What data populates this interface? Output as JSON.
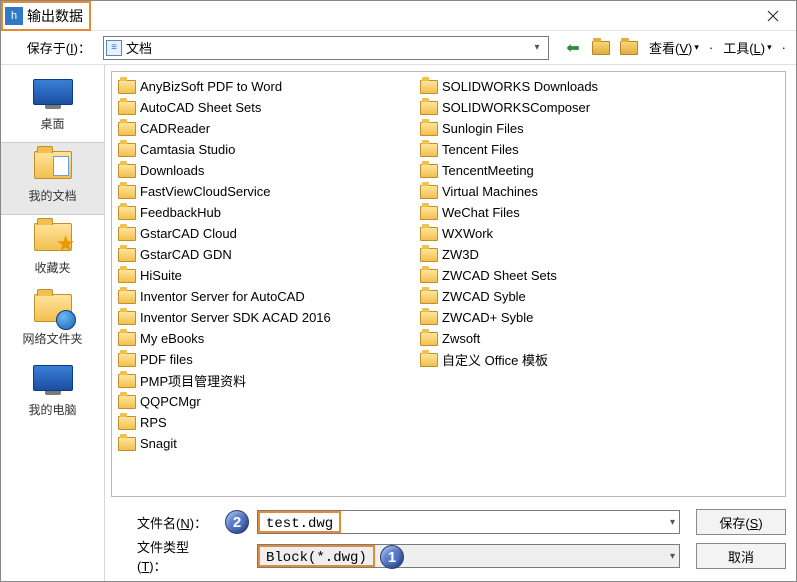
{
  "title": "输出数据",
  "labels": {
    "save_in": "保存于(I)：",
    "filename": "文件名(N)：",
    "filetype": "文件类型(T)："
  },
  "save_in_value": "文档",
  "toolbar_menu": {
    "view": "查看(V)",
    "tools": "工具(L)"
  },
  "places": [
    {
      "label": "桌面"
    },
    {
      "label": "我的文档",
      "selected": true
    },
    {
      "label": "收藏夹"
    },
    {
      "label": "网络文件夹"
    },
    {
      "label": "我的电脑"
    }
  ],
  "folders_col1": [
    "AnyBizSoft PDF to Word",
    "AutoCAD Sheet Sets",
    "CADReader",
    "Camtasia Studio",
    "Downloads",
    "FastViewCloudService",
    "FeedbackHub",
    "GstarCAD Cloud",
    "GstarCAD GDN",
    "HiSuite",
    "Inventor Server for AutoCAD",
    "Inventor Server SDK ACAD 2016",
    "My eBooks",
    "PDF files",
    "PMP项目管理资料",
    "QQPCMgr",
    "RPS",
    "Snagit"
  ],
  "folders_col2": [
    "SOLIDWORKS Downloads",
    "SOLIDWORKSComposer",
    "Sunlogin Files",
    "Tencent Files",
    "TencentMeeting",
    "Virtual Machines",
    "WeChat Files",
    "WXWork",
    "ZW3D",
    "ZWCAD Sheet Sets",
    "ZWCAD Syble",
    "ZWCAD+ Syble",
    "Zwsoft",
    "自定义 Office 模板"
  ],
  "filename_value": "test.dwg",
  "filetype_value": "Block(*.dwg)",
  "buttons": {
    "save": "保存(S)",
    "cancel": "取消"
  },
  "annotations": {
    "step1": "1",
    "step2": "2"
  }
}
